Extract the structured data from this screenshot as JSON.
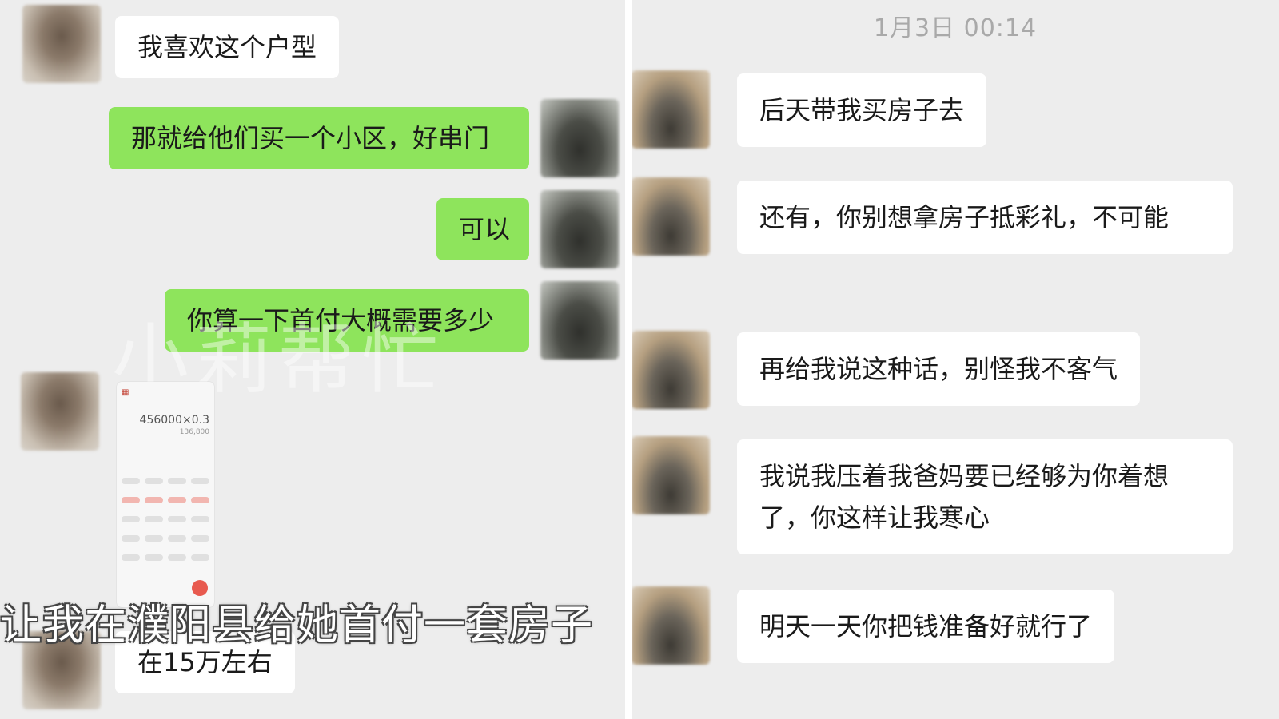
{
  "left_panel": {
    "messages": [
      {
        "side": "in",
        "text": "我喜欢这个户型"
      },
      {
        "side": "out",
        "text": "那就给他们买一个小区，好串门"
      },
      {
        "side": "out",
        "text": "可以"
      },
      {
        "side": "out",
        "text": "你算一下首付大概需要多少"
      },
      {
        "side": "in",
        "text": "在15万左右"
      }
    ],
    "calc_image": {
      "expression": "456000×0.3",
      "result": "136,800"
    },
    "watermark": "小莉帮忙",
    "subtitle": "让我在濮阳县给她首付一套房子"
  },
  "right_panel": {
    "timestamp": "1月3日 00:14",
    "messages": [
      {
        "side": "in",
        "text": "后天带我买房子去"
      },
      {
        "side": "in",
        "text": "还有，你别想拿房子抵彩礼，不可能"
      },
      {
        "side": "in",
        "text": "再给我说这种话，别怪我不客气"
      },
      {
        "side": "in",
        "text": "我说我压着我爸妈要已经够为你着想了，你这样让我寒心"
      },
      {
        "side": "in",
        "text": "明天一天你把钱准备好就行了"
      }
    ]
  },
  "colors": {
    "chat_bg": "#ededed",
    "bubble_in": "#ffffff",
    "bubble_out": "#8ee45c"
  }
}
